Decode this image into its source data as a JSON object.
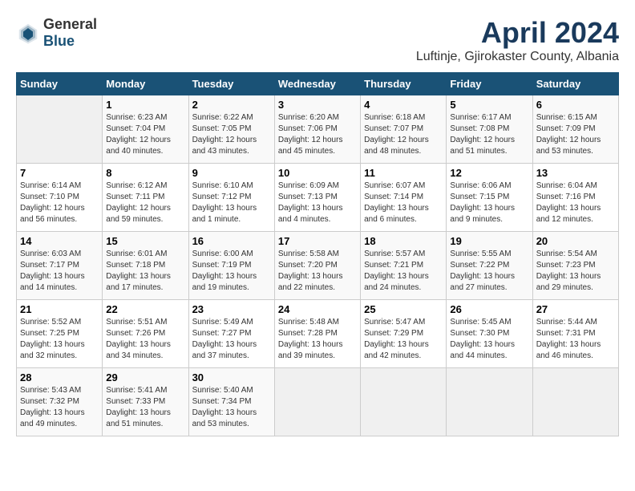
{
  "logo": {
    "general": "General",
    "blue": "Blue"
  },
  "title": "April 2024",
  "location": "Luftinje, Gjirokaster County, Albania",
  "days_header": [
    "Sunday",
    "Monday",
    "Tuesday",
    "Wednesday",
    "Thursday",
    "Friday",
    "Saturday"
  ],
  "weeks": [
    [
      {
        "day": "",
        "info": ""
      },
      {
        "day": "1",
        "info": "Sunrise: 6:23 AM\nSunset: 7:04 PM\nDaylight: 12 hours\nand 40 minutes."
      },
      {
        "day": "2",
        "info": "Sunrise: 6:22 AM\nSunset: 7:05 PM\nDaylight: 12 hours\nand 43 minutes."
      },
      {
        "day": "3",
        "info": "Sunrise: 6:20 AM\nSunset: 7:06 PM\nDaylight: 12 hours\nand 45 minutes."
      },
      {
        "day": "4",
        "info": "Sunrise: 6:18 AM\nSunset: 7:07 PM\nDaylight: 12 hours\nand 48 minutes."
      },
      {
        "day": "5",
        "info": "Sunrise: 6:17 AM\nSunset: 7:08 PM\nDaylight: 12 hours\nand 51 minutes."
      },
      {
        "day": "6",
        "info": "Sunrise: 6:15 AM\nSunset: 7:09 PM\nDaylight: 12 hours\nand 53 minutes."
      }
    ],
    [
      {
        "day": "7",
        "info": "Sunrise: 6:14 AM\nSunset: 7:10 PM\nDaylight: 12 hours\nand 56 minutes."
      },
      {
        "day": "8",
        "info": "Sunrise: 6:12 AM\nSunset: 7:11 PM\nDaylight: 12 hours\nand 59 minutes."
      },
      {
        "day": "9",
        "info": "Sunrise: 6:10 AM\nSunset: 7:12 PM\nDaylight: 13 hours\nand 1 minute."
      },
      {
        "day": "10",
        "info": "Sunrise: 6:09 AM\nSunset: 7:13 PM\nDaylight: 13 hours\nand 4 minutes."
      },
      {
        "day": "11",
        "info": "Sunrise: 6:07 AM\nSunset: 7:14 PM\nDaylight: 13 hours\nand 6 minutes."
      },
      {
        "day": "12",
        "info": "Sunrise: 6:06 AM\nSunset: 7:15 PM\nDaylight: 13 hours\nand 9 minutes."
      },
      {
        "day": "13",
        "info": "Sunrise: 6:04 AM\nSunset: 7:16 PM\nDaylight: 13 hours\nand 12 minutes."
      }
    ],
    [
      {
        "day": "14",
        "info": "Sunrise: 6:03 AM\nSunset: 7:17 PM\nDaylight: 13 hours\nand 14 minutes."
      },
      {
        "day": "15",
        "info": "Sunrise: 6:01 AM\nSunset: 7:18 PM\nDaylight: 13 hours\nand 17 minutes."
      },
      {
        "day": "16",
        "info": "Sunrise: 6:00 AM\nSunset: 7:19 PM\nDaylight: 13 hours\nand 19 minutes."
      },
      {
        "day": "17",
        "info": "Sunrise: 5:58 AM\nSunset: 7:20 PM\nDaylight: 13 hours\nand 22 minutes."
      },
      {
        "day": "18",
        "info": "Sunrise: 5:57 AM\nSunset: 7:21 PM\nDaylight: 13 hours\nand 24 minutes."
      },
      {
        "day": "19",
        "info": "Sunrise: 5:55 AM\nSunset: 7:22 PM\nDaylight: 13 hours\nand 27 minutes."
      },
      {
        "day": "20",
        "info": "Sunrise: 5:54 AM\nSunset: 7:23 PM\nDaylight: 13 hours\nand 29 minutes."
      }
    ],
    [
      {
        "day": "21",
        "info": "Sunrise: 5:52 AM\nSunset: 7:25 PM\nDaylight: 13 hours\nand 32 minutes."
      },
      {
        "day": "22",
        "info": "Sunrise: 5:51 AM\nSunset: 7:26 PM\nDaylight: 13 hours\nand 34 minutes."
      },
      {
        "day": "23",
        "info": "Sunrise: 5:49 AM\nSunset: 7:27 PM\nDaylight: 13 hours\nand 37 minutes."
      },
      {
        "day": "24",
        "info": "Sunrise: 5:48 AM\nSunset: 7:28 PM\nDaylight: 13 hours\nand 39 minutes."
      },
      {
        "day": "25",
        "info": "Sunrise: 5:47 AM\nSunset: 7:29 PM\nDaylight: 13 hours\nand 42 minutes."
      },
      {
        "day": "26",
        "info": "Sunrise: 5:45 AM\nSunset: 7:30 PM\nDaylight: 13 hours\nand 44 minutes."
      },
      {
        "day": "27",
        "info": "Sunrise: 5:44 AM\nSunset: 7:31 PM\nDaylight: 13 hours\nand 46 minutes."
      }
    ],
    [
      {
        "day": "28",
        "info": "Sunrise: 5:43 AM\nSunset: 7:32 PM\nDaylight: 13 hours\nand 49 minutes."
      },
      {
        "day": "29",
        "info": "Sunrise: 5:41 AM\nSunset: 7:33 PM\nDaylight: 13 hours\nand 51 minutes."
      },
      {
        "day": "30",
        "info": "Sunrise: 5:40 AM\nSunset: 7:34 PM\nDaylight: 13 hours\nand 53 minutes."
      },
      {
        "day": "",
        "info": ""
      },
      {
        "day": "",
        "info": ""
      },
      {
        "day": "",
        "info": ""
      },
      {
        "day": "",
        "info": ""
      }
    ]
  ]
}
